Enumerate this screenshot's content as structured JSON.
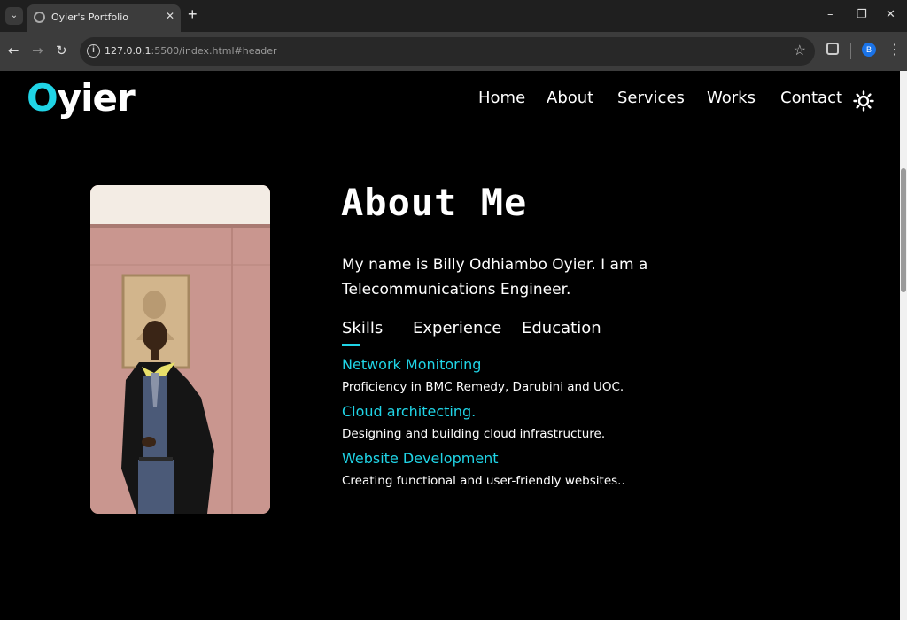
{
  "browser": {
    "tab_title": "Oyier's Portfolio",
    "url_host": "127.0.0.1",
    "url_path": ":5500/index.html#header",
    "profile_initial": "B"
  },
  "site": {
    "logo_first": "O",
    "logo_rest": "yier",
    "accent_color": "#20d4e6",
    "nav": [
      "Home",
      "About",
      "Services",
      "Works",
      "Contact"
    ]
  },
  "about": {
    "title": "About Me",
    "intro": "My name is Billy Odhiambo Oyier. I am a Telecommunications Engineer.",
    "tabs": [
      "Skills",
      "Experience",
      "Education"
    ],
    "active_tab": "Skills",
    "skills": [
      {
        "title": "Network Monitoring",
        "desc": "Proficiency in BMC Remedy, Darubini and UOC."
      },
      {
        "title": "Cloud architecting.",
        "desc": "Designing and building cloud infrastructure."
      },
      {
        "title": "Website Development",
        "desc": "Creating functional and user-friendly websites.."
      }
    ]
  }
}
